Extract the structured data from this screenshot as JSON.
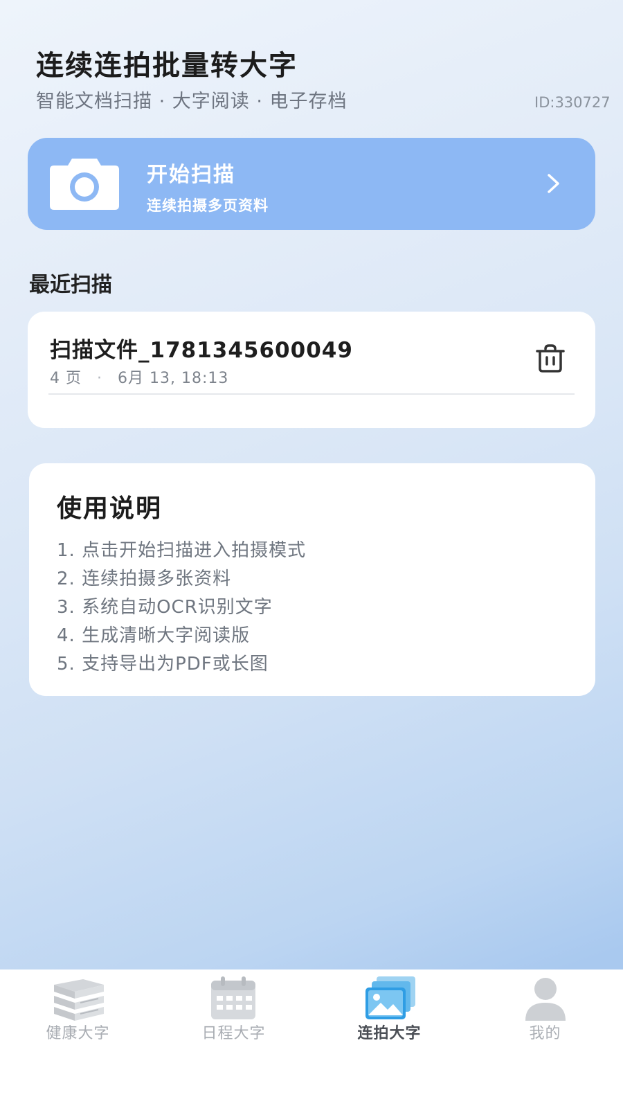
{
  "header": {
    "title": "连续连拍批量转大字",
    "subtitle": "智能文档扫描 · 大字阅读 · 电子存档",
    "user_id": "ID:330727"
  },
  "scan_banner": {
    "title": "开始扫描",
    "subtitle": "连续拍摄多页资料",
    "icon": "camera-icon",
    "color": "#8db8f4"
  },
  "recent": {
    "section_title": "最近扫描",
    "items": [
      {
        "name": "扫描文件_1781345600049",
        "pages": "4 页",
        "separator": "·",
        "time": "6月 13, 18:13"
      }
    ]
  },
  "guide": {
    "title": "使用说明",
    "steps": [
      "1. 点击开始扫描进入拍摄模式",
      "2. 连续拍摄多张资料",
      "3. 系统自动OCR识别文字",
      "4. 生成清晰大字阅读版",
      "5. 支持导出为PDF或长图"
    ]
  },
  "bottom_nav": {
    "items": [
      {
        "label": "健康大字",
        "icon": "book-stack-icon",
        "active": false
      },
      {
        "label": "日程大字",
        "icon": "calendar-icon",
        "active": false
      },
      {
        "label": "连拍大字",
        "icon": "gallery-icon",
        "active": true
      },
      {
        "label": "我的",
        "icon": "user-icon",
        "active": false
      }
    ],
    "active_color": "#3aa8e8"
  }
}
